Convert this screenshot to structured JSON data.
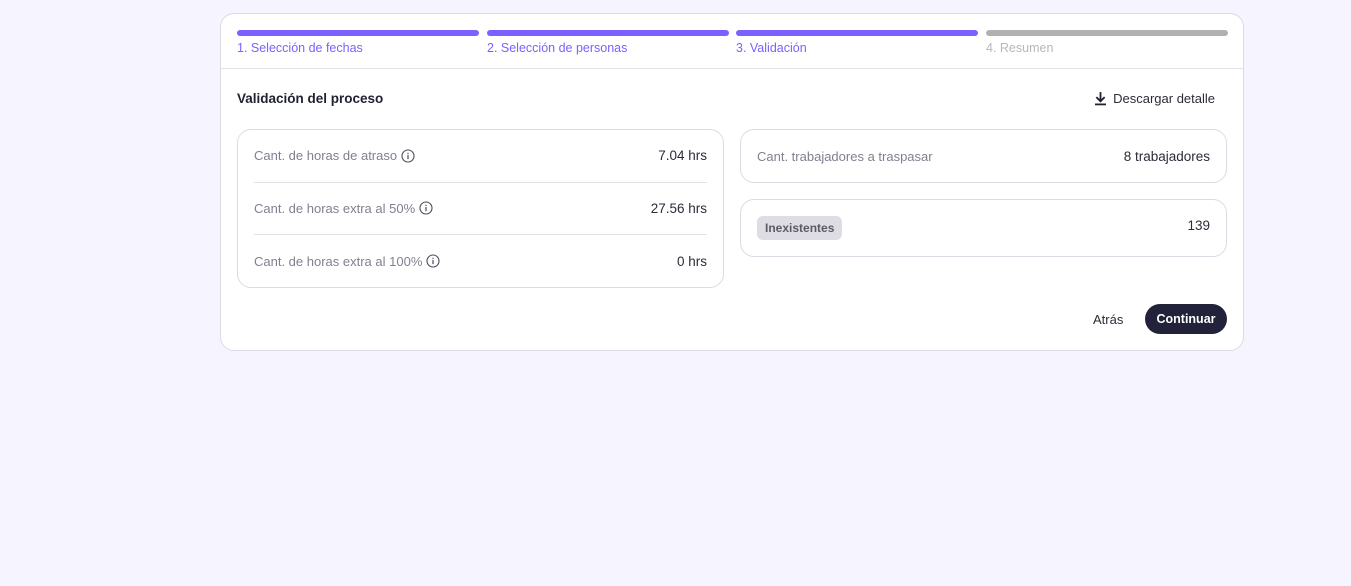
{
  "stepper": {
    "steps": [
      {
        "label": "1. Selección de fechas",
        "state": "complete"
      },
      {
        "label": "2. Selección de personas",
        "state": "complete"
      },
      {
        "label": "3. Validación",
        "state": "active"
      },
      {
        "label": "4. Resumen",
        "state": "pending"
      }
    ]
  },
  "section": {
    "title": "Validación del proceso",
    "download_label": "Descargar detalle"
  },
  "hours": {
    "rows": [
      {
        "label": "Cant. de horas de atraso",
        "value": "7.04 hrs"
      },
      {
        "label": "Cant. de horas extra al 50%",
        "value": "27.56 hrs"
      },
      {
        "label": "Cant. de horas extra al 100%",
        "value": "0 hrs"
      }
    ]
  },
  "workers": {
    "label": "Cant. trabajadores a traspasar",
    "value": "8 trabajadores"
  },
  "missing": {
    "badge": "Inexistentes",
    "count": "139"
  },
  "actions": {
    "back_label": "Atrás",
    "continue_label": "Continuar"
  },
  "colors": {
    "accent": "#7b61ff",
    "inactive": "#b1b1b1",
    "primary_button": "#22223a",
    "background": "#f6f4fe"
  }
}
